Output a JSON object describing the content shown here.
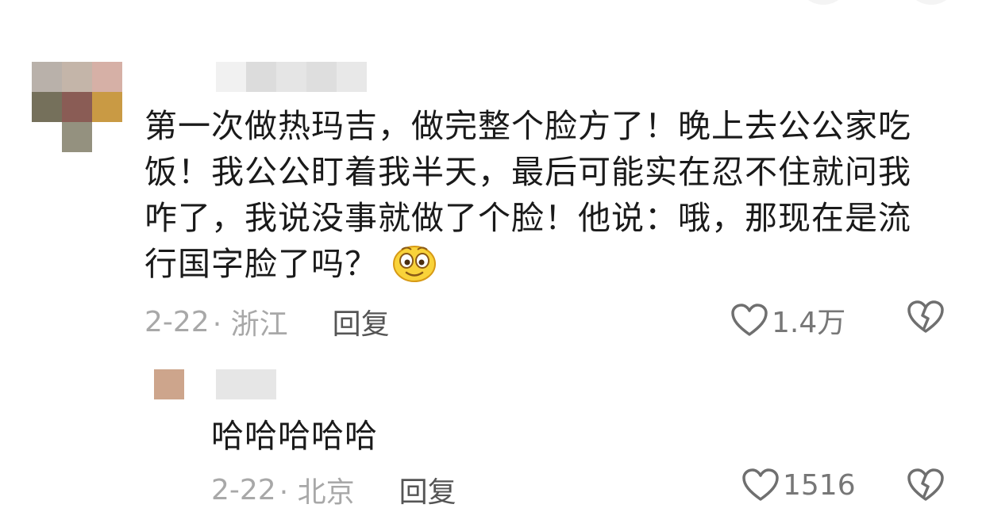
{
  "comment": {
    "text": "第一次做热玛吉，做完整个脸方了！晚上去公公家吃饭！我公公盯着我半天，最后可能实在忍不住就问我咋了，我说没事就做了个脸！他说：哦，那现在是流行国字脸了吗？",
    "date": "2-22",
    "location": "· 浙江",
    "reply_label": "回复",
    "likes": "1.4万",
    "emoji": "smiling-face-emoji"
  },
  "reply": {
    "text": "哈哈哈哈哈",
    "date": "2-22",
    "location": "· 北京",
    "reply_label": "回复",
    "likes": "1516"
  },
  "icons": {
    "like": "heart-outline-icon",
    "dislike": "broken-heart-icon"
  },
  "colors": {
    "text_primary": "#1a1a1a",
    "text_meta": "#a8a8a8",
    "reply_action": "#555555",
    "like_count": "#777777",
    "emoji_yellow": "#f9d33a"
  }
}
